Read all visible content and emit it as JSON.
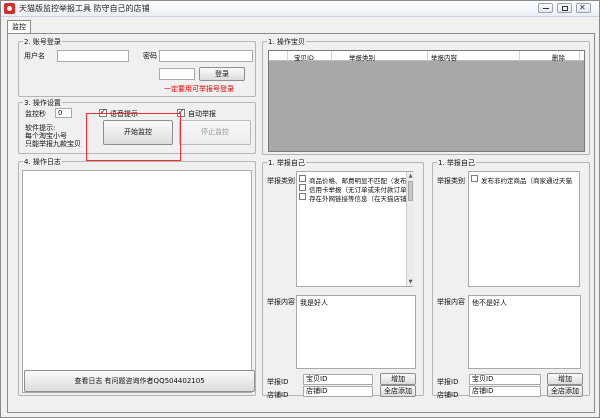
{
  "window": {
    "title": "天猫版监控举报工具  防守自己的店铺",
    "icon": "tmall-cat-icon"
  },
  "tabs": [
    {
      "label": "监控"
    }
  ],
  "account_login": {
    "title": "2. 账号登录",
    "username_label": "用户名",
    "username_value": "",
    "password_label": "密码",
    "password_value": "",
    "captcha_value": "",
    "login_button": "登录",
    "hint": "一定要用可举报号登录"
  },
  "operation_settings": {
    "title": "3. 操作设置",
    "interval_label": "监控秒",
    "interval_value": "0",
    "voice_prompt_label": "语音提示",
    "voice_prompt_checked": true,
    "auto_report_label": "自动举报",
    "auto_report_checked": true,
    "software_hint_label": "软件提示:",
    "hint_line1": "每个淘宝小号",
    "hint_line2": "只能举报九款宝贝",
    "start_button": "开始监控",
    "stop_button": "停止监控"
  },
  "operation_log": {
    "title": "4. 操作日志",
    "view_log_button": "查看日志   有问题咨询作者QQ504402105"
  },
  "operate_items": {
    "title": "1. 操作宝贝",
    "columns": [
      "宝贝ID",
      "举报类别",
      "举报内容",
      "删除"
    ]
  },
  "report_self_left": {
    "title": "1. 举报自己",
    "category_label": "举报类别",
    "categories": [
      {
        "label": "商品价格、邮费明显不匹配（发布",
        "checked": false
      },
      {
        "label": "信用卡举报（无订单或未付款订单",
        "checked": false
      },
      {
        "label": "存在外网链接等信息（在天猫店铺",
        "checked": false
      }
    ],
    "content_label": "举报内容",
    "content_value": "我是好人",
    "item_id_label": "举报ID",
    "item_id_value": "宝贝ID",
    "add_button": "增加",
    "shop_id_label": "店铺ID",
    "shop_id_value": "店铺ID",
    "shop_add_button": "全店添加"
  },
  "report_self_right": {
    "title": "1. 举报自己",
    "category_label": "举报类别",
    "categories": [
      {
        "label": "发布非约定商品（商家通过天猫",
        "checked": false
      }
    ],
    "content_label": "举报内容",
    "content_value": "他不是好人",
    "item_id_label": "举报ID",
    "item_id_value": "宝贝ID",
    "add_button": "增加",
    "shop_id_label": "店铺ID",
    "shop_id_value": "店铺ID",
    "shop_add_button": "全店添加"
  },
  "colors": {
    "accent_red": "#e00000",
    "highlight_red": "#e53333",
    "listview_bg": "#a8a8a8"
  }
}
